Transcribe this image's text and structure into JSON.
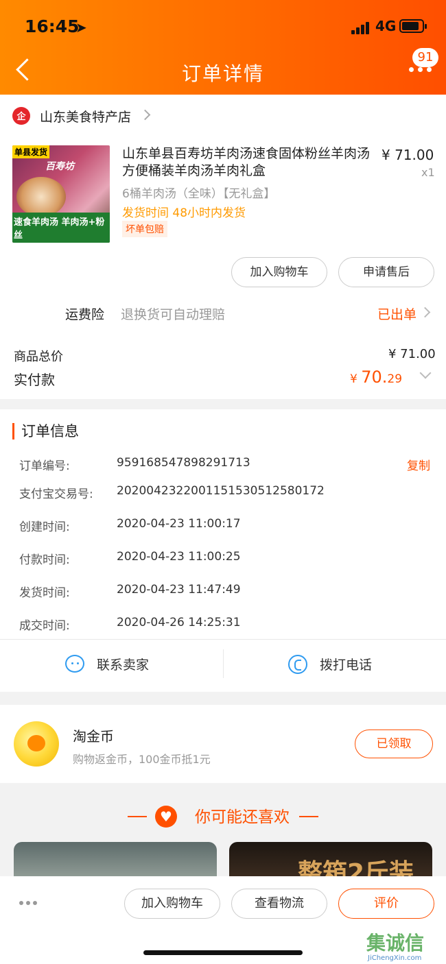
{
  "status_bar": {
    "time": "16:45",
    "network": "4G"
  },
  "header": {
    "title": "订单详情",
    "badge_count": "91"
  },
  "shop": {
    "name": "山东美食特产店"
  },
  "product": {
    "title": "山东单县百寿坊羊肉汤速食固体粉丝羊肉汤方便桶装羊肉汤羊肉礼盒",
    "price": "¥ 71.00",
    "quantity": "x1",
    "sku": "6桶羊肉汤（全味）【无礼盒】",
    "shipping": "发货时间  48小时内发货",
    "tag": "坏单包赔",
    "image_text": {
      "tag_top": "单县发货",
      "brand": "百寿坊",
      "bottom": "速食羊肉汤 羊肉汤+粉丝"
    }
  },
  "actions": {
    "add_to_cart": "加入购物车",
    "after_sale": "申请售后"
  },
  "insurance": {
    "label": "运费险",
    "desc": "退换货可自动理赔",
    "status": "已出单"
  },
  "summary": {
    "total_label": "商品总价",
    "total_value": "¥ 71.00",
    "paid_label": "实付款",
    "paid_currency": "¥ ",
    "paid_int": "70.",
    "paid_dec": "29"
  },
  "order_info": {
    "title": "订单信息",
    "copy": "复制",
    "rows": [
      {
        "label": "订单编号:",
        "value": "959168547898291713"
      },
      {
        "label": "支付宝交易号:",
        "value": "2020042322001151530512580172"
      },
      {
        "label": "创建时间:",
        "value": "2020-04-23 11:00:17"
      },
      {
        "label": "付款时间:",
        "value": "2020-04-23 11:00:25"
      },
      {
        "label": "发货时间:",
        "value": "2020-04-23 11:47:49"
      },
      {
        "label": "成交时间:",
        "value": "2020-04-26 14:25:31"
      }
    ]
  },
  "contact": {
    "seller": "联系卖家",
    "call": "拨打电话"
  },
  "coins": {
    "title": "淘金币",
    "desc": "购物返金币，100金币抵1元",
    "button": "已领取"
  },
  "recommend": {
    "title": "你可能还喜欢",
    "card2_text": "整箱2斤装"
  },
  "bottom_bar": {
    "add_cart": "加入购物车",
    "logistics": "查看物流",
    "review": "评价"
  },
  "watermark": {
    "text": "集诚信",
    "url": "JiChengXin.com"
  },
  "colors": {
    "accent": "#ff5000",
    "header_start": "#ff8a00",
    "header_end": "#ff4f00",
    "link_blue": "#2f9bf0"
  }
}
